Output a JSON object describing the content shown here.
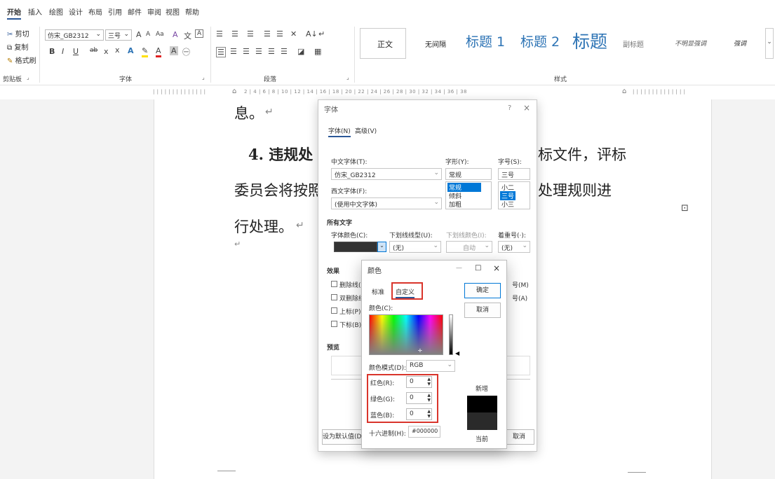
{
  "tabs": [
    "开始",
    "插入",
    "绘图",
    "设计",
    "布局",
    "引用",
    "邮件",
    "审阅",
    "视图",
    "帮助"
  ],
  "clipboard": {
    "cut": "剪切",
    "copy": "复制",
    "format_painter": "格式刷",
    "group": "剪贴板"
  },
  "font_group": {
    "font_name": "仿宋_GB2312",
    "font_size": "三号",
    "grow": "A",
    "shrink": "A",
    "case": "Aa",
    "clear": "A",
    "phonetic": "文",
    "border": "A",
    "bold": "B",
    "italic": "I",
    "underline": "U",
    "strike": "ab",
    "sub": "x",
    "sup": "x",
    "effects": "A",
    "highlight": "A",
    "font_color": "A",
    "shade": "A",
    "enclose": "㊀",
    "label": "字体"
  },
  "paragraph_group": {
    "label": "段落",
    "sort": "A↓",
    "mark": "↵"
  },
  "styles_group": {
    "label": "样式",
    "items": [
      {
        "text": "正文"
      },
      {
        "text": "无间隔"
      },
      {
        "text": "标题 1"
      },
      {
        "text": "标题 2"
      },
      {
        "text": "标题"
      },
      {
        "text": "副标题"
      },
      {
        "text": "不明显强调"
      },
      {
        "text": "强调"
      }
    ]
  },
  "ruler": {
    "left": "| | | | | | | | | | | | | |",
    "marks": "2 | 4 | 6 | 8 | 10 | 12 | 14 | 16 | 18 | 20 | 22 | 24 | 26 | 28 | 30 | 32 | 34 | 36 | 38",
    "right": "| | | | | | | | | | | | | |"
  },
  "document": {
    "line_top": "息。",
    "line1_left": "4. 违规处",
    "line1_right": "标文件，评标",
    "line2_left": "委员会将按照",
    "line2_right": "处理规则进",
    "line3": "行处理。",
    "para_mark": "↵"
  },
  "font_dialog": {
    "title": "字体",
    "help": "?",
    "close": "×",
    "tabs": [
      "字体(N)",
      "高级(V)"
    ],
    "cn_font_label": "中文字体(T):",
    "cn_font_value": "仿宋_GB2312",
    "west_font_label": "西文字体(F):",
    "west_font_value": "(使用中文字体)",
    "style_label": "字形(Y):",
    "style_value": "常规",
    "style_options": [
      "常规",
      "倾斜",
      "加粗"
    ],
    "size_label": "字号(S):",
    "size_value": "三号",
    "size_options": [
      "小二",
      "三号",
      "小三"
    ],
    "all_text": "所有文字",
    "font_color_label": "字体颜色(C):",
    "underline_label": "下划线线型(U):",
    "underline_value": "(无)",
    "underline_color_label": "下划线颜色(I):",
    "underline_color_value": "自动",
    "emphasis_label": "着重号(·):",
    "emphasis_value": "(无)",
    "effects": "效果",
    "strikethrough": "删除线(K)",
    "double_strike": "双删除线",
    "superscript": "上标(P)",
    "subscript": "下标(B)",
    "small_caps_frag": "号(M)",
    "all_caps_frag": "号(A)",
    "preview": "预览",
    "set_default": "设为默认值(D)",
    "cancel": "取消"
  },
  "color_dialog": {
    "title": "颜色",
    "minimize": "—",
    "maximize": "□",
    "close": "×",
    "tabs": [
      "标准",
      "自定义"
    ],
    "ok": "确定",
    "cancel": "取消",
    "colors_label": "颜色(C):",
    "mode_label": "颜色模式(D):",
    "mode_value": "RGB",
    "red_label": "红色(R):",
    "red_value": "0",
    "green_label": "绿色(G):",
    "green_value": "0",
    "blue_label": "蓝色(B):",
    "blue_value": "0",
    "hex_label": "十六进制(H):",
    "hex_value": "#000000",
    "new_label": "新增",
    "current_label": "当前",
    "new_color": "#000000",
    "current_color": "#2a2a2a",
    "highlight_color": "#d9342b"
  },
  "comment_icon": "↵"
}
